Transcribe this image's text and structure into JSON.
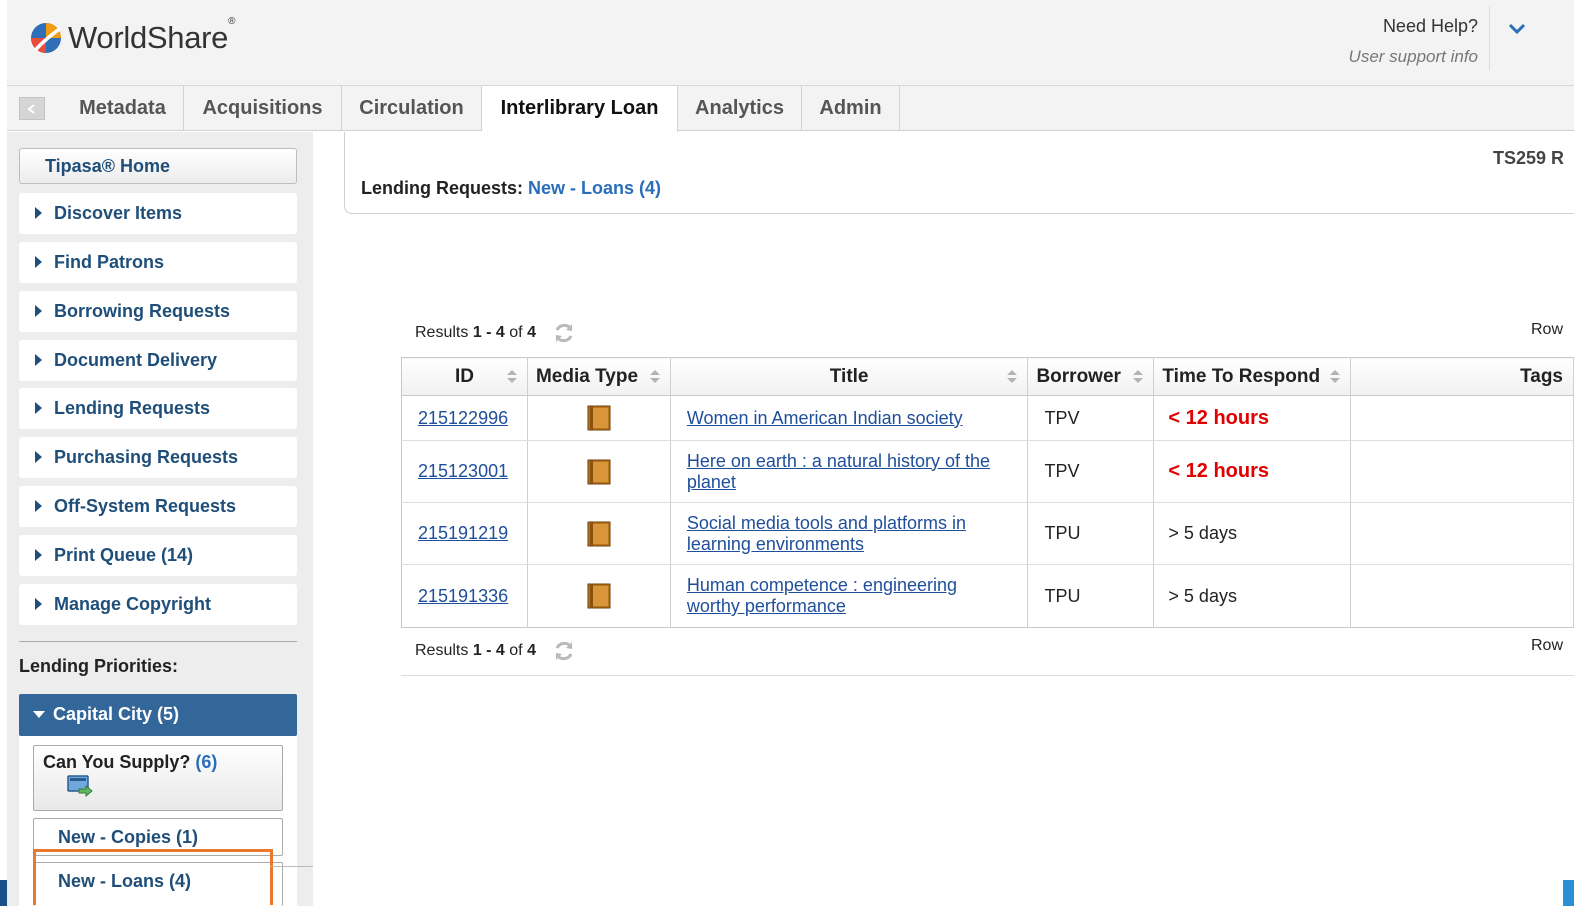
{
  "header": {
    "brand": "WorldShare",
    "brand_mark": "®",
    "help_title": "Need Help?",
    "help_sub": "User support info"
  },
  "nav": {
    "tabs": [
      "Metadata",
      "Acquisitions",
      "Circulation",
      "Interlibrary Loan",
      "Analytics",
      "Admin"
    ],
    "active": "Interlibrary Loan"
  },
  "sidebar": {
    "home": "Tipasa® Home",
    "items": [
      "Discover Items",
      "Find Patrons",
      "Borrowing Requests",
      "Document Delivery",
      "Lending Requests",
      "Purchasing Requests",
      "Off-System Requests",
      "Print Queue (14)",
      "Manage Copyright"
    ],
    "priorities_label": "Lending Priorities:",
    "group": "Capital City (5)",
    "supply_label": "Can You Supply?",
    "supply_count": "(6)",
    "sub_items": [
      "New - Copies (1)",
      "New - Loans (4)"
    ]
  },
  "main": {
    "label": "Lending Requests:",
    "value": "New - Loans (4)",
    "right_text": "TS259 R",
    "results_prefix": "Results",
    "results_range": "1 - 4",
    "results_of": "of",
    "results_total": "4",
    "rows_label": "Row",
    "rows_label_bottom": "Row"
  },
  "table": {
    "columns": [
      "ID",
      "Media Type",
      "Title",
      "Borrower",
      "Time To Respond",
      "Tags"
    ],
    "rows": [
      {
        "id": "215122996",
        "title": "Women in American Indian society",
        "borrower": "TPV",
        "time": "< 12 hours",
        "urgent": true
      },
      {
        "id": "215123001",
        "title": "Here on earth : a natural history of the planet",
        "borrower": "TPV",
        "time": "< 12 hours",
        "urgent": true
      },
      {
        "id": "215191219",
        "title": "Social media tools and platforms in learning environments",
        "borrower": "TPU",
        "time": "> 5 days",
        "urgent": false
      },
      {
        "id": "215191336",
        "title": "Human competence : engineering worthy performance",
        "borrower": "TPU",
        "time": "> 5 days",
        "urgent": false
      }
    ]
  },
  "colors": {
    "link": "#1f4e9a",
    "sidebar_text": "#1f4e79",
    "active_group": "#336699",
    "urgent": "#e00000",
    "highlight": "#e8782f"
  },
  "icons": [
    "worldshare-logo-icon",
    "chevron-down-icon",
    "collapse-sidebar-icon",
    "refresh-icon",
    "book-icon",
    "supply-screen-icon"
  ]
}
